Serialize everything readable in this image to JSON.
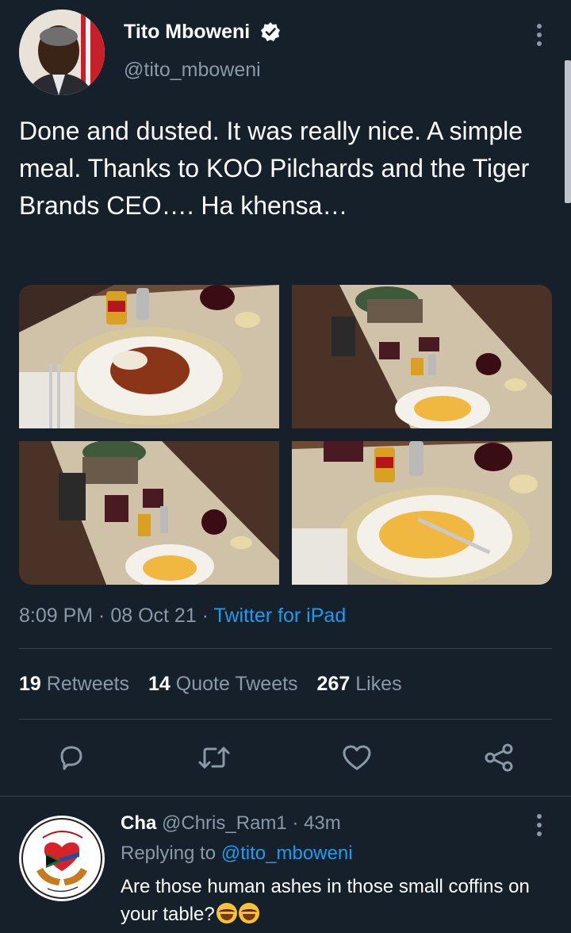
{
  "tweet": {
    "author_name": "Tito Mboweni",
    "author_handle": "@tito_mboweni",
    "text": "Done and dusted. It was really nice. A simple meal. Thanks to KOO Pilchards and the Tiger Brands CEO…. Ha khensa…",
    "time": "8:09 PM",
    "date": "08 Oct 21",
    "source": "Twitter for iPad",
    "separator": " · "
  },
  "stats": {
    "retweets_count": "19",
    "retweets_label": "Retweets",
    "quotes_count": "14",
    "quotes_label": "Quote Tweets",
    "likes_count": "267",
    "likes_label": "Likes"
  },
  "actions": {
    "icons": [
      "reply-icon",
      "retweet-icon",
      "like-icon",
      "share-icon"
    ]
  },
  "reply": {
    "name": "Cha",
    "handle": "@Chris_Ram1",
    "time": "43m",
    "separator": " · ",
    "replying_label": "Replying to",
    "replying_to": "@tito_mboweni",
    "text": "Are those human ashes in those small coffins on your table?"
  },
  "colors": {
    "background": "#15202b",
    "secondary_text": "#8b98a5",
    "accent": "#1d9bf0",
    "divider": "#38444d"
  }
}
